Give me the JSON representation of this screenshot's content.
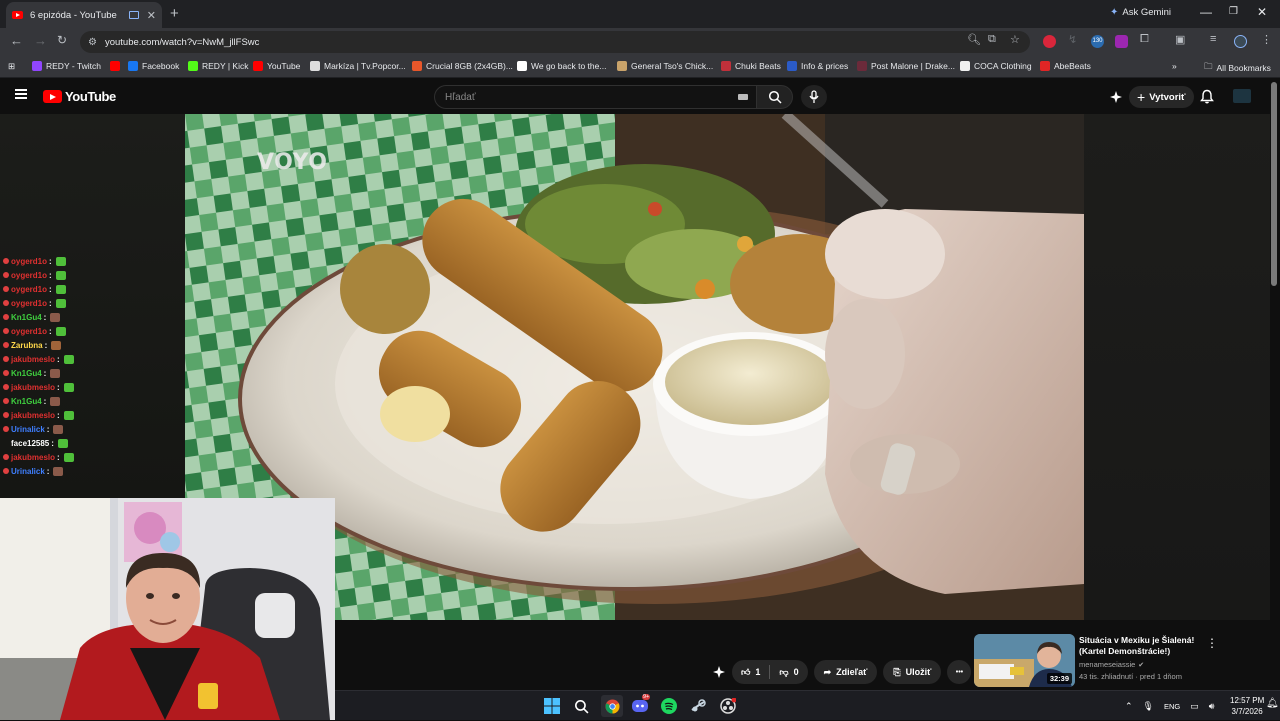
{
  "browser": {
    "tab_title": "6 epizóda - YouTube",
    "new_tab": "+",
    "ask_gemini": "Ask Gemini",
    "url": "youtube.com/watch?v=NwM_jllFSwc",
    "bookmarks": [
      {
        "label": "REDY - Twitch",
        "icon_color": "#9146ff"
      },
      {
        "label": "",
        "icon_color": "#ff0000"
      },
      {
        "label": "Facebook",
        "icon_color": "#1877f2"
      },
      {
        "label": "REDY | Kick",
        "icon_color": "#53fc18"
      },
      {
        "label": "YouTube",
        "icon_color": "#ff0000"
      },
      {
        "label": "Markíza | Tv.Popcor...",
        "icon_color": "#dddddd"
      },
      {
        "label": "Crucial 8GB (2x4GB)...",
        "icon_color": "#e8572a"
      },
      {
        "label": "We go back to the...",
        "icon_color": "#ffffff"
      },
      {
        "label": "General Tso's Chick...",
        "icon_color": "#c9a36a"
      },
      {
        "label": "Chuki Beats",
        "icon_color": "#c0303a"
      },
      {
        "label": "Info & prices",
        "icon_color": "#2b5bc7"
      },
      {
        "label": "Post Malone | Drake...",
        "icon_color": "#6b2a3a"
      },
      {
        "label": "COCA Clothing",
        "icon_color": "#f0f0f0"
      },
      {
        "label": "AbeBeats",
        "icon_color": "#e02525"
      }
    ],
    "bookmarks_more": "»",
    "all_bookmarks": "All Bookmarks",
    "extension_badge": "130"
  },
  "youtube": {
    "logo_text": "YouTube",
    "search_placeholder": "Hľadať",
    "create_label": "Vytvoriť",
    "video_watermark": "VOYO",
    "like_count": "1",
    "dislike_count": "0",
    "share_label": "Zdieľať",
    "save_label": "Uložiť",
    "more_label": "•••",
    "recommended": {
      "title": "Situácia v Mexiku je Šialená! (Kartel Demonštrácie!)",
      "channel": "menameseiassie",
      "meta": "43 tis. zhliadnutí · pred 1 dňom",
      "duration": "32:39"
    }
  },
  "chat": {
    "lines": [
      {
        "user": "oygerd1o",
        "user_color": "#e03030",
        "emote_color": "#4fbf3a"
      },
      {
        "user": "oygerd1o",
        "user_color": "#e03030",
        "emote_color": "#4fbf3a"
      },
      {
        "user": "oygerd1o",
        "user_color": "#e03030",
        "emote_color": "#4fbf3a"
      },
      {
        "user": "oygerd1o",
        "user_color": "#e03030",
        "emote_color": "#4fbf3a"
      },
      {
        "user": "Kn1Gu4",
        "user_color": "#3fcf3f",
        "emote_color": "#8a5a4a"
      },
      {
        "user": "oygerd1o",
        "user_color": "#e03030",
        "emote_color": "#4fbf3a"
      },
      {
        "user": "Zarubna",
        "user_color": "#ffd84a",
        "emote_color": "#a0643a"
      },
      {
        "user": "jakubmeslo",
        "user_color": "#e03030",
        "emote_color": "#4fbf3a"
      },
      {
        "user": "Kn1Gu4",
        "user_color": "#3fcf3f",
        "emote_color": "#8a5a4a"
      },
      {
        "user": "jakubmeslo",
        "user_color": "#e03030",
        "emote_color": "#4fbf3a"
      },
      {
        "user": "Kn1Gu4",
        "user_color": "#3fcf3f",
        "emote_color": "#8a5a4a"
      },
      {
        "user": "jakubmeslo",
        "user_color": "#e03030",
        "emote_color": "#4fbf3a"
      },
      {
        "user": "Urinalick",
        "user_color": "#3f7fff",
        "emote_color": "#8a5a4a"
      },
      {
        "user": "face12585",
        "user_color": "#ffffff",
        "emote_color": "#4fbf3a"
      },
      {
        "user": "jakubmeslo",
        "user_color": "#e03030",
        "emote_color": "#4fbf3a"
      },
      {
        "user": "Urinalick",
        "user_color": "#3f7fff",
        "emote_color": "#8a5a4a"
      }
    ],
    "separator": ":"
  },
  "taskbar": {
    "language": "ENG",
    "time": "12:57 PM",
    "date": "3/7/2026",
    "discord_badge": "9+"
  },
  "colors": {
    "yt_red": "#ff0000",
    "chrome_bg": "#35363a",
    "page_bg": "#0f0f0f"
  }
}
